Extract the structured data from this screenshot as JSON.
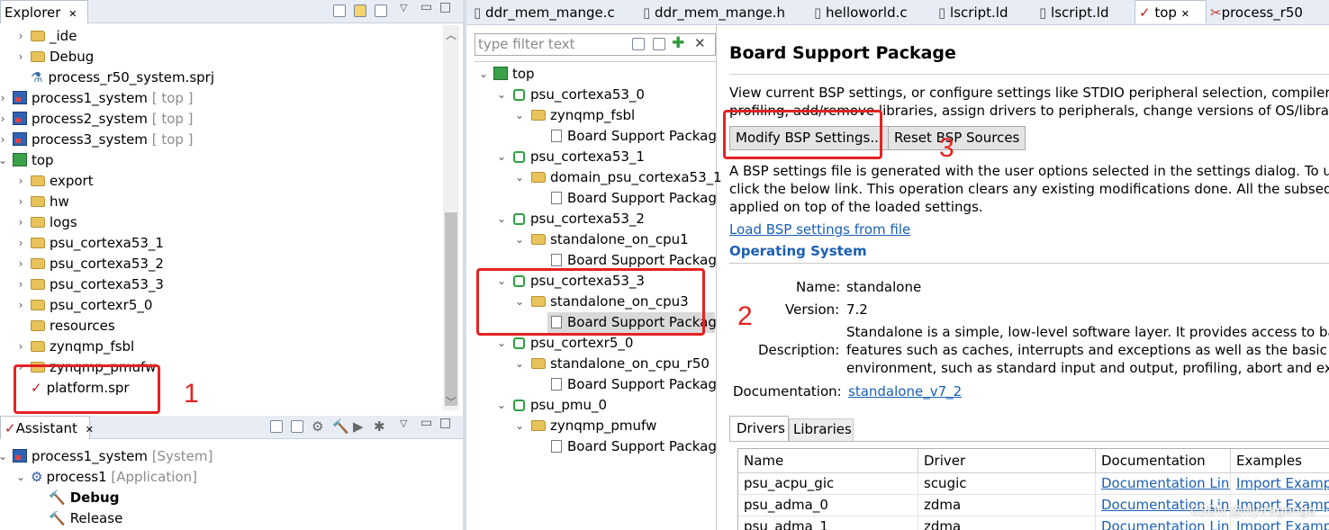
{
  "explorer": {
    "title": "Explorer",
    "items": [
      {
        "label": "_ide",
        "note": ""
      },
      {
        "label": "Debug",
        "note": ""
      },
      {
        "label": "process_r50_system.sprj",
        "note": ""
      },
      {
        "label": "process1_system",
        "note": "[ top ]"
      },
      {
        "label": "process2_system",
        "note": "[ top ]"
      },
      {
        "label": "process3_system",
        "note": "[ top ]"
      },
      {
        "label": "top",
        "note": ""
      },
      {
        "label": "export",
        "note": ""
      },
      {
        "label": "hw",
        "note": ""
      },
      {
        "label": "logs",
        "note": ""
      },
      {
        "label": "psu_cortexa53_1",
        "note": ""
      },
      {
        "label": "psu_cortexa53_2",
        "note": ""
      },
      {
        "label": "psu_cortexa53_3",
        "note": ""
      },
      {
        "label": "psu_cortexr5_0",
        "note": ""
      },
      {
        "label": "resources",
        "note": ""
      },
      {
        "label": "zynqmp_fsbl",
        "note": ""
      },
      {
        "label": "zynqmp_pmufw",
        "note": ""
      },
      {
        "label": "platform.spr",
        "note": ""
      }
    ]
  },
  "assistant": {
    "title": "Assistant",
    "items": [
      {
        "label": "process1_system",
        "note": "[System]"
      },
      {
        "label": "process1",
        "note": "[Application]"
      },
      {
        "label": "Debug",
        "note": ""
      },
      {
        "label": "Release",
        "note": ""
      }
    ]
  },
  "editor_tabs": [
    {
      "label": "ddr_mem_mange.c"
    },
    {
      "label": "ddr_mem_mange.h"
    },
    {
      "label": "helloworld.c"
    },
    {
      "label": "lscript.ld"
    },
    {
      "label": "lscript.ld"
    },
    {
      "label": "top"
    },
    {
      "label": "process_r50"
    }
  ],
  "platform_tree": {
    "filter_placeholder": "type filter text",
    "items": [
      {
        "label": "top"
      },
      {
        "label": "psu_cortexa53_0"
      },
      {
        "label": "zynqmp_fsbl"
      },
      {
        "label": "Board Support Packag"
      },
      {
        "label": "psu_cortexa53_1"
      },
      {
        "label": "domain_psu_cortexa53_1"
      },
      {
        "label": "Board Support Packag"
      },
      {
        "label": "psu_cortexa53_2"
      },
      {
        "label": "standalone_on_cpu1"
      },
      {
        "label": "Board Support Packag"
      },
      {
        "label": "psu_cortexa53_3"
      },
      {
        "label": "standalone_on_cpu3"
      },
      {
        "label": "Board Support Packag"
      },
      {
        "label": "psu_cortexr5_0"
      },
      {
        "label": "standalone_on_cpu_r50"
      },
      {
        "label": "Board Support Packag"
      },
      {
        "label": "psu_pmu_0"
      },
      {
        "label": "zynqmp_pmufw"
      },
      {
        "label": "Board Support Packag"
      }
    ]
  },
  "bsp": {
    "heading": "Board Support Package",
    "desc_line1": "View current BSP settings, or configure settings like STDIO peripheral selection, compiler fla",
    "desc_line2": "profiling, add/remove libraries, assign drivers to peripherals, change versions of OS/libraries",
    "modify_btn": "Modify BSP Settings...",
    "reset_btn": "Reset BSP Sources",
    "info_line1": "A BSP settings file is generated with the user options selected in the settings dialog. To use",
    "info_line2": "click the below link. This operation clears any existing modifications done. All the subsequent",
    "info_line3": "applied on top of the loaded settings.",
    "load_link": "Load BSP settings from file",
    "os_section": "Operating System",
    "name_label": "Name:",
    "name_value": "standalone",
    "version_label": "Version:",
    "version_value": "7.2",
    "description_label": "Description:",
    "desc_value1": "Standalone is a simple, low-level software layer. It provides access to basic",
    "desc_value2": "features such as caches, interrupts and exceptions as well as the basic feat",
    "desc_value3": "environment, such as standard input and output, profiling, abort and exit.",
    "documentation_label": "Documentation:",
    "documentation_link": "standalone_v7_2",
    "tabs": [
      "Drivers",
      "Libraries"
    ],
    "table": {
      "headers": [
        "Name",
        "Driver",
        "Documentation",
        "Examples"
      ],
      "rows": [
        [
          "psu_acpu_gic",
          "scugic",
          "Documentation Link",
          "Import Examples"
        ],
        [
          "psu_adma_0",
          "zdma",
          "Documentation Link",
          "Import Examples"
        ],
        [
          "psu_adma_1",
          "zdma",
          "Documentation Link",
          "Import Examples"
        ]
      ]
    }
  },
  "annotations": {
    "n1": "1",
    "n2": "2",
    "n3": "3"
  },
  "watermark": "CSDN @Nyiragongo"
}
